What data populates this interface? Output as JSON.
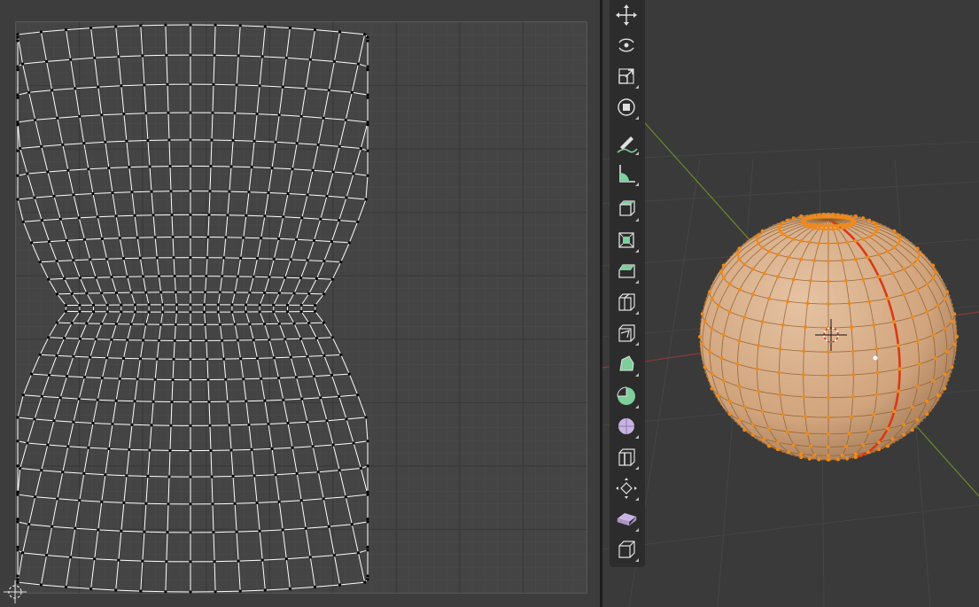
{
  "uv_editor": {
    "grid_background": "#444444",
    "mesh_color": "#ffffff",
    "vertex_color": "#000000"
  },
  "viewport": {
    "sphere_color": "#d6aa84",
    "edge_color": "#e07a10",
    "seam_color": "#d83a14",
    "x_axis_color": "#8a3a3a",
    "y_axis_color": "#6b8b2a"
  },
  "toolbar": {
    "tools": [
      {
        "name": "move-tool-icon"
      },
      {
        "name": "rotate-tool-icon"
      },
      {
        "name": "scale-tool-icon"
      },
      {
        "name": "transform-tool-icon"
      },
      {
        "name": "annotate-tool-icon"
      },
      {
        "name": "measure-tool-icon"
      },
      {
        "name": "extrude-region-tool-icon"
      },
      {
        "name": "inset-faces-tool-icon"
      },
      {
        "name": "bevel-tool-icon"
      },
      {
        "name": "loop-cut-tool-icon"
      },
      {
        "name": "knife-tool-icon"
      },
      {
        "name": "poly-build-tool-icon"
      },
      {
        "name": "spin-tool-icon"
      },
      {
        "name": "smooth-tool-icon"
      },
      {
        "name": "edge-slide-tool-icon"
      },
      {
        "name": "shrink-fatten-tool-icon"
      },
      {
        "name": "shear-tool-icon"
      },
      {
        "name": "rip-region-tool-icon"
      }
    ]
  }
}
